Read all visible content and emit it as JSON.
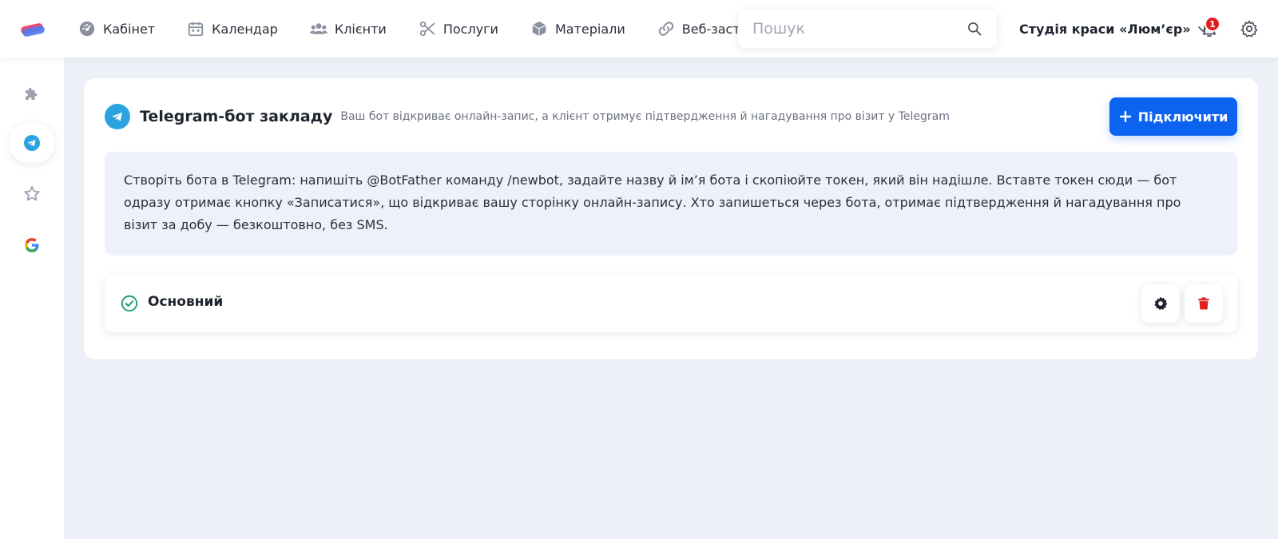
{
  "topbar": {
    "nav": [
      {
        "label": "Кабінет",
        "icon": "dashboard-icon"
      },
      {
        "label": "Календар",
        "icon": "calendar-icon"
      },
      {
        "label": "Клієнти",
        "icon": "users-icon"
      },
      {
        "label": "Послуги",
        "icon": "scissors-icon"
      },
      {
        "label": "Матеріали",
        "icon": "box-icon"
      },
      {
        "label": "Веб-застосунок",
        "icon": "link-icon"
      }
    ],
    "search_placeholder": "Пошук",
    "studio_name": "Студія краси «Люм’єр»",
    "notifications_count": "1"
  },
  "sidebar": {
    "items": [
      {
        "icon": "puzzle-icon",
        "active": false
      },
      {
        "icon": "telegram-icon",
        "active": true
      },
      {
        "icon": "star-icon",
        "active": false
      },
      {
        "icon": "google-icon",
        "active": false
      }
    ]
  },
  "main": {
    "title": "Telegram-бот закладу",
    "subtitle": "Ваш бот відкриває онлайн-запис, а клієнт отримує підтвердження й нагадування про візит у Telegram",
    "connect_label": "Підключити",
    "info_text": "Створіть бота в Telegram: напишіть @BotFather команду /newbot, задайте назву й ім’я бота і скопіюйте токен, який він надішле. Вставте токен сюди — бот одразу отримає кнопку «Записатися», що відкриває вашу сторінку онлайн-запису. Хто запишеться через бота, отримає підтвердження й нагадування про візит за добу — безкоштовно, без SMS.",
    "bots": [
      {
        "name": "Основний",
        "status": "active"
      }
    ]
  },
  "colors": {
    "accent": "#0b63f0",
    "telegram": "#2aa3e0",
    "success": "#1a9c6a",
    "danger": "#e11d1d"
  }
}
